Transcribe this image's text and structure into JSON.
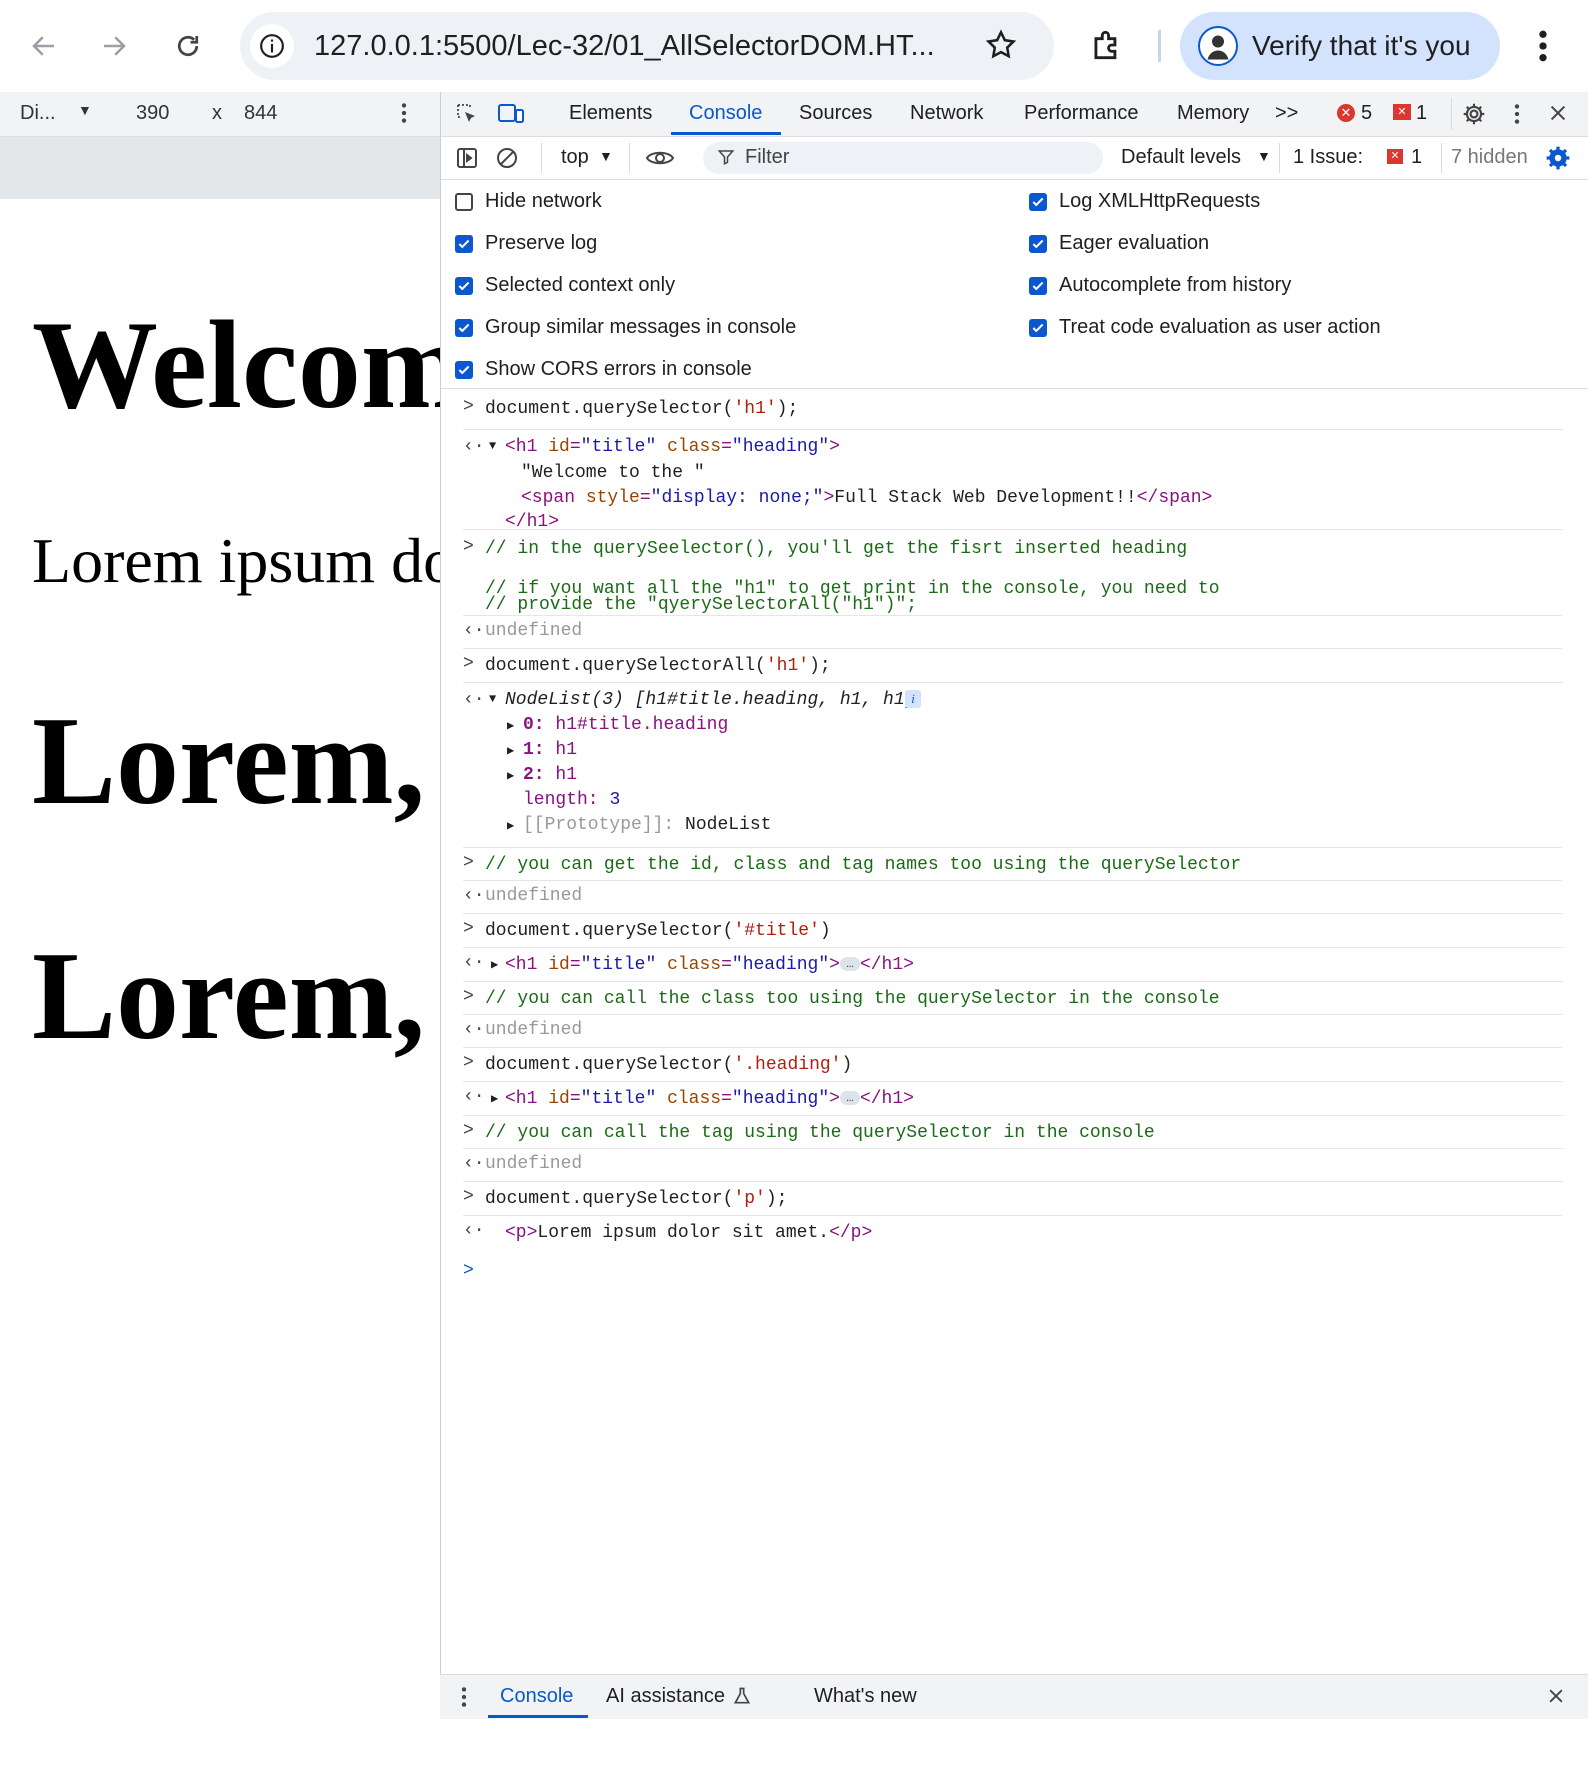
{
  "browser": {
    "url": "127.0.0.1:5500/Lec-32/01_AllSelectorDOM.HT...",
    "verify_label": "Verify that it's you"
  },
  "device_toolbar": {
    "device": "Di...",
    "width": "390",
    "times": "x",
    "height": "844"
  },
  "page": {
    "h1_title": "Welcom",
    "paragraph": "Lorem ipsum do",
    "h1_second": "Lorem,",
    "h1_third": "Lorem,"
  },
  "devtools": {
    "tabs": [
      "Elements",
      "Console",
      "Sources",
      "Network",
      "Performance",
      "Memory"
    ],
    "more_tabs": ">>",
    "error_count": "5",
    "issue_count": "1",
    "context": "top",
    "filter_placeholder": "Filter",
    "levels": "Default levels",
    "issues_label": "1 Issue:",
    "issues_num": "1",
    "hidden_label": "7 hidden",
    "settings_left": [
      {
        "label": "Hide network",
        "checked": false
      },
      {
        "label": "Preserve log",
        "checked": true
      },
      {
        "label": "Selected context only",
        "checked": true
      },
      {
        "label": "Group similar messages in console",
        "checked": true
      },
      {
        "label": "Show CORS errors in console",
        "checked": true
      }
    ],
    "settings_right": [
      {
        "label": "Log XMLHttpRequests",
        "checked": true
      },
      {
        "label": "Eager evaluation",
        "checked": true
      },
      {
        "label": "Autocomplete from history",
        "checked": true
      },
      {
        "label": "Treat code evaluation as user action",
        "checked": true
      }
    ]
  },
  "console": {
    "l1_a": "document.querySelector(",
    "l1_str": "'h1'",
    "l1_b": ");",
    "r1_open_tag": "<h1 ",
    "r1_id_attr": "id",
    "r1_id_val": "\"title\"",
    "r1_class_attr": "class",
    "r1_class_val": "\"heading\"",
    "r1_close": ">",
    "r1_text": "\"Welcome to the \"",
    "r1_span_open": "<span ",
    "r1_span_attr": "style",
    "r1_span_val": "\"display: none;\"",
    "r1_span_gt": ">",
    "r1_span_text": "Full Stack Web Development!!",
    "r1_span_close": "</span>",
    "r1_end": "</h1>",
    "c1_a": "// in the querySeelector(), you'll get the fisrt inserted heading",
    "c1_b": "// if you want all the \"h1\" to get print in the console, you need to",
    "c1_c": "// provide the \"qyerySelectorAll(\"h1\")\";",
    "undefined": "undefined",
    "l2_a": "document.querySelectorAll(",
    "l2_str": "'h1'",
    "l2_b": ");",
    "nl_head": "NodeList(3) [h1#title.heading, h1, h1]",
    "nl_0_key": "0:",
    "nl_0_val": "h1#title.heading",
    "nl_1_key": "1:",
    "nl_1_val": "h1",
    "nl_2_key": "2:",
    "nl_2_val": "h1",
    "nl_len_key": "length:",
    "nl_len_val": "3",
    "nl_proto_key": "[[Prototype]]:",
    "nl_proto_val": "NodeList",
    "c2": "// you can get the id, class and tag names too using the querySelector",
    "l3_a": "document.querySelector(",
    "l3_str": "'#title'",
    "l3_b": ")",
    "ellipsis": "…",
    "h1_close": "</h1>",
    "c3": "// you can call the class too using the querySelector in the console",
    "l4_a": "document.querySelector(",
    "l4_str": "'.heading'",
    "l4_b": ")",
    "c4": "// you can call the tag using the querySelector in the console",
    "l5_a": "document.querySelector(",
    "l5_str": "'p'",
    "l5_b": ");",
    "p_open": "<p>",
    "p_text": "Lorem ipsum dolor sit amet.",
    "p_close": "</p>"
  },
  "drawer": {
    "tabs": [
      "Console",
      "AI assistance",
      "What's new"
    ]
  }
}
